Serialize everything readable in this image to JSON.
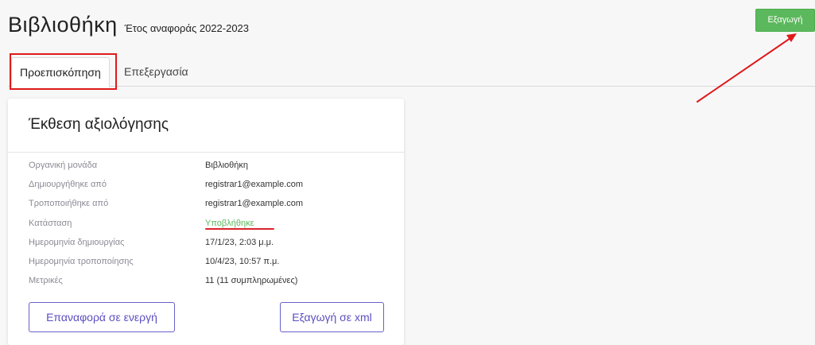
{
  "header": {
    "title": "Βιβλιοθήκη",
    "subtitle": "Έτος αναφοράς 2022-2023",
    "export_label": "Εξαγωγή"
  },
  "tabs": [
    {
      "label": "Προεπισκόπηση",
      "active": true
    },
    {
      "label": "Επεξεργασία",
      "active": false
    }
  ],
  "card": {
    "title": "Έκθεση αξιολόγησης",
    "rows": [
      {
        "label": "Οργανική μονάδα",
        "value": "Βιβλιοθήκη"
      },
      {
        "label": "Δημιουργήθηκε από",
        "value": "registrar1@example.com"
      },
      {
        "label": "Τροποποιήθηκε από",
        "value": "registrar1@example.com"
      },
      {
        "label": "Κατάσταση",
        "value": "Υποβλήθηκε"
      },
      {
        "label": "Ημερομηνία δημιουργίας",
        "value": "17/1/23, 2:03 μ.μ."
      },
      {
        "label": "Ημερομηνία τροποποίησης",
        "value": "10/4/23, 10:57 π.μ."
      },
      {
        "label": "Μετρικές",
        "value": "11 (11 συμπληρωμένες)"
      }
    ],
    "restore_label": "Επαναφορά σε ενεργή",
    "export_xml_label": "Εξαγωγή σε xml"
  },
  "colors": {
    "accent": "#5a4fc1",
    "success": "#5cb85c",
    "annotation": "#e01a1a"
  }
}
